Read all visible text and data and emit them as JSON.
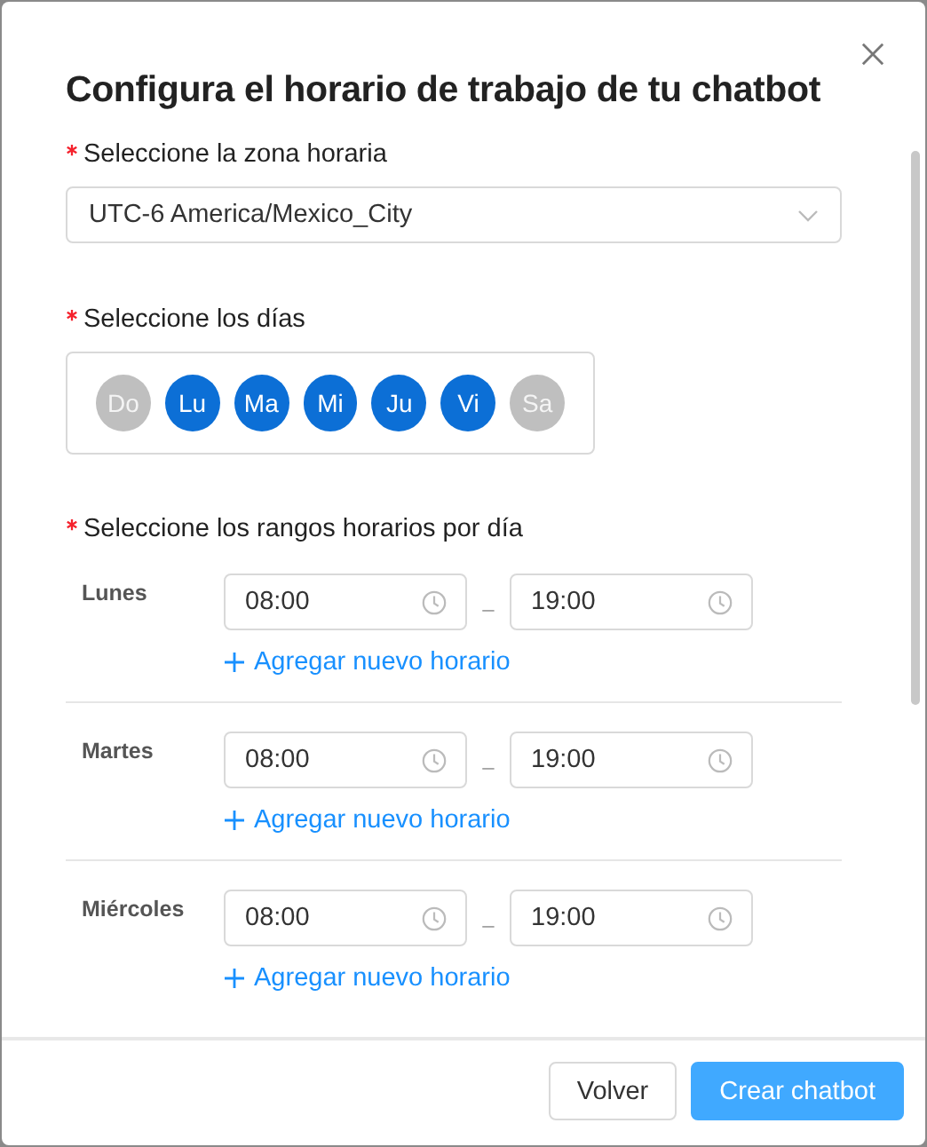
{
  "dialog": {
    "title": "Configura el horario de trabajo de tu chatbot"
  },
  "timezone": {
    "label": "Seleccione la zona horaria",
    "required": true,
    "value": "UTC-6 America/Mexico_City"
  },
  "days": {
    "label": "Seleccione los días",
    "required": true,
    "items": [
      {
        "label": "Do",
        "selected": false
      },
      {
        "label": "Lu",
        "selected": true
      },
      {
        "label": "Ma",
        "selected": true
      },
      {
        "label": "Mi",
        "selected": true
      },
      {
        "label": "Ju",
        "selected": true
      },
      {
        "label": "Vi",
        "selected": true
      },
      {
        "label": "Sa",
        "selected": false
      }
    ]
  },
  "ranges": {
    "label": "Seleccione los rangos horarios por día",
    "required": true,
    "rows": [
      {
        "day": "Lunes",
        "start": "08:00",
        "end": "19:00",
        "separator": "–",
        "add_link": "Agregar nuevo horario"
      },
      {
        "day": "Martes",
        "start": "08:00",
        "end": "19:00",
        "separator": "–",
        "add_link": "Agregar nuevo horario"
      },
      {
        "day": "Miércoles",
        "start": "08:00",
        "end": "19:00",
        "separator": "–",
        "add_link": "Agregar nuevo horario"
      }
    ]
  },
  "buttons": [
    {
      "label": "Volver",
      "kind": "secondary"
    },
    {
      "label": "Crear chatbot",
      "kind": "primary"
    }
  ]
}
